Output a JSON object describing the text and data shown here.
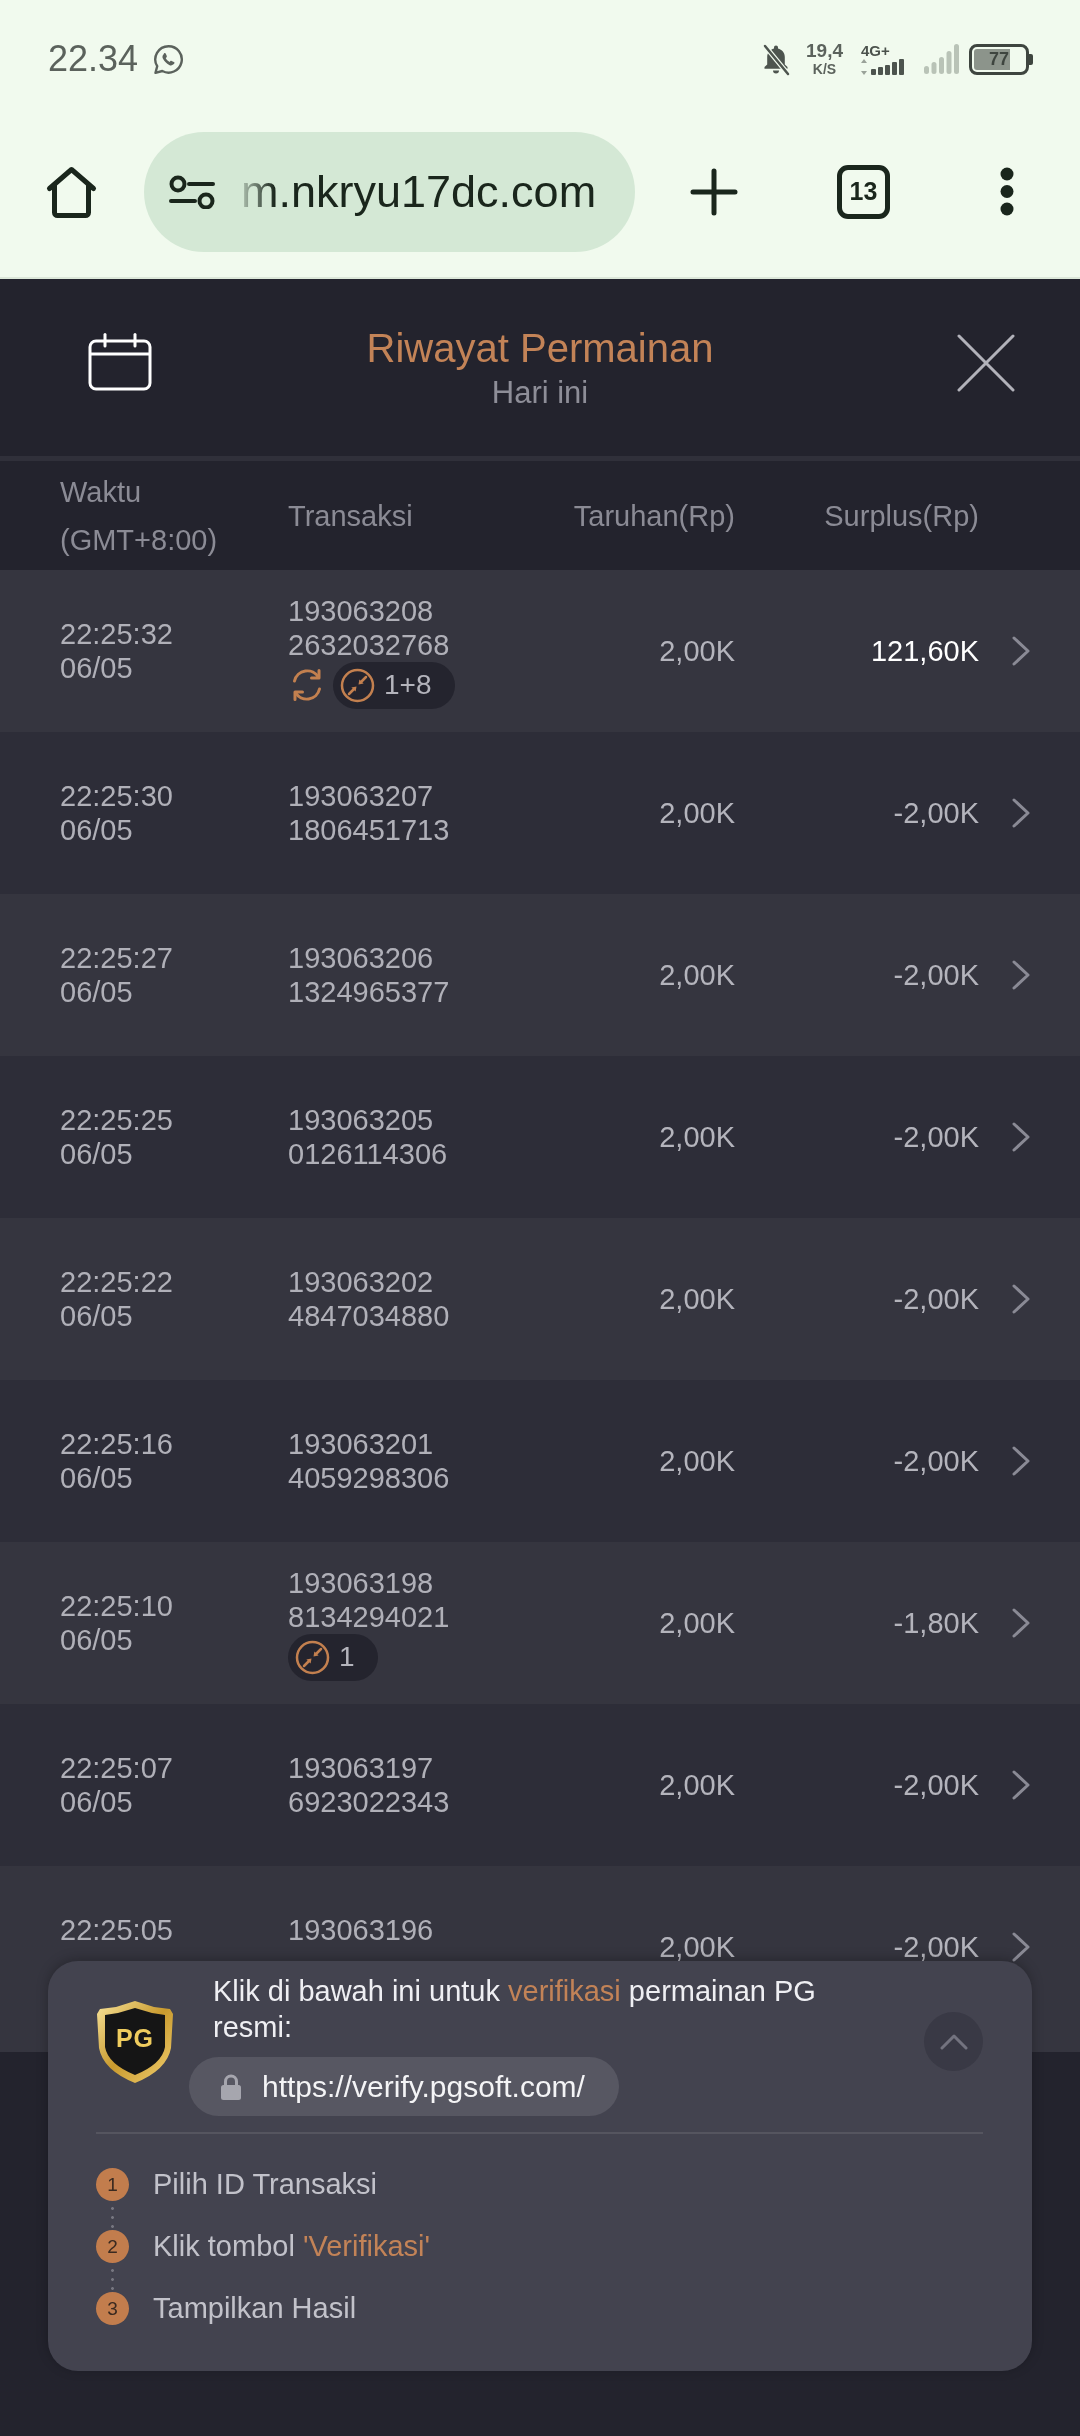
{
  "status_bar": {
    "time": "22.34",
    "speed_value": "19,4",
    "speed_unit": "K/S",
    "network_type": "4G+",
    "battery": "77"
  },
  "browser": {
    "url": "m.nkryu17dc.com",
    "tab_count": "13"
  },
  "header": {
    "title": "Riwayat Permainan",
    "subtitle": "Hari ini"
  },
  "table": {
    "columns": [
      "Waktu (GMT+8:00)",
      "Transaksi",
      "Taruhan(Rp)",
      "Surplus(Rp)"
    ],
    "rows": [
      {
        "time": "22:25:32",
        "date": "06/05",
        "transaction_id": "193063208",
        "round_id": "2632032768",
        "tags": [
          {
            "kind": "refresh"
          },
          {
            "kind": "count",
            "text": "1+8"
          }
        ],
        "bet": "2,00K",
        "surplus": "121,60K",
        "win": true
      },
      {
        "time": "22:25:30",
        "date": "06/05",
        "transaction_id": "193063207",
        "round_id": "1806451713",
        "bet": "2,00K",
        "surplus": "-2,00K",
        "win": false
      },
      {
        "time": "22:25:27",
        "date": "06/05",
        "transaction_id": "193063206",
        "round_id": "1324965377",
        "bet": "2,00K",
        "surplus": "-2,00K",
        "win": false
      },
      {
        "time": "22:25:25",
        "date": "06/05",
        "transaction_id": "193063205",
        "round_id": "0126114306",
        "bet": "2,00K",
        "surplus": "-2,00K",
        "win": false
      },
      {
        "time": "22:25:22",
        "date": "06/05",
        "transaction_id": "193063202",
        "round_id": "4847034880",
        "bet": "2,00K",
        "surplus": "-2,00K",
        "win": false
      },
      {
        "time": "22:25:16",
        "date": "06/05",
        "transaction_id": "193063201",
        "round_id": "4059298306",
        "bet": "2,00K",
        "surplus": "-2,00K",
        "win": false
      },
      {
        "time": "22:25:10",
        "date": "06/05",
        "transaction_id": "193063198",
        "round_id": "8134294021",
        "tags": [
          {
            "kind": "count",
            "text": "1"
          }
        ],
        "bet": "2,00K",
        "surplus": "-1,80K",
        "win": false
      },
      {
        "time": "22:25:07",
        "date": "06/05",
        "transaction_id": "193063197",
        "round_id": "6923022343",
        "bet": "2,00K",
        "surplus": "-2,00K",
        "win": false
      },
      {
        "time": "22:25:05",
        "transaction_id": "193063196",
        "bet": "2,00K",
        "surplus": "-2,00K",
        "win": false
      }
    ]
  },
  "verify_panel": {
    "logo": "PG",
    "message": [
      {
        "text": "Klik di bawah ini untuk ",
        "highlight": false
      },
      {
        "text": "verifikasi",
        "highlight": true
      },
      {
        "text": " permainan PG resmi:",
        "highlight": false
      }
    ],
    "link": "https://verify.pgsoft.com/",
    "steps": [
      {
        "number": "1",
        "parts": [
          {
            "text": "Pilih ID Transaksi",
            "highlight": false
          }
        ]
      },
      {
        "number": "2",
        "parts": [
          {
            "text": "Klik tombol ",
            "highlight": false
          },
          {
            "text": "'Verifikasi'",
            "highlight": true
          }
        ]
      },
      {
        "number": "3",
        "parts": [
          {
            "text": "Tampilkan Hasil",
            "highlight": false
          }
        ]
      }
    ]
  }
}
